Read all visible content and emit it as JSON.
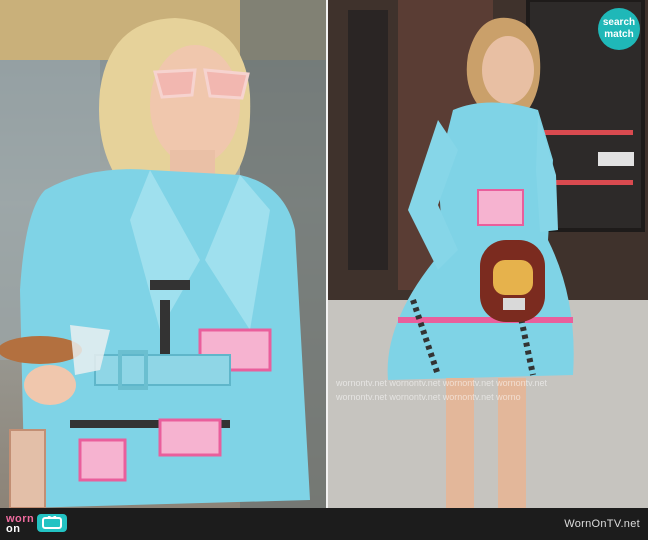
{
  "badge": {
    "line1": "search",
    "line2": "match",
    "color": "#1fb8b8"
  },
  "footer": {
    "brand_main": "worn",
    "brand_sub": "on",
    "tv_icon": "tv-icon",
    "site_text": "WornOnTV.net"
  },
  "watermark": {
    "row1": "wornontv.net   wornontv.net   wornontv.net   wornontv.net",
    "row2": "wornontv.net   wornontv.net   wornontv.net   worno"
  },
  "colors": {
    "coat": "#7fd3e6",
    "pink": "#e95f9c",
    "accent": "#23c3c3"
  }
}
